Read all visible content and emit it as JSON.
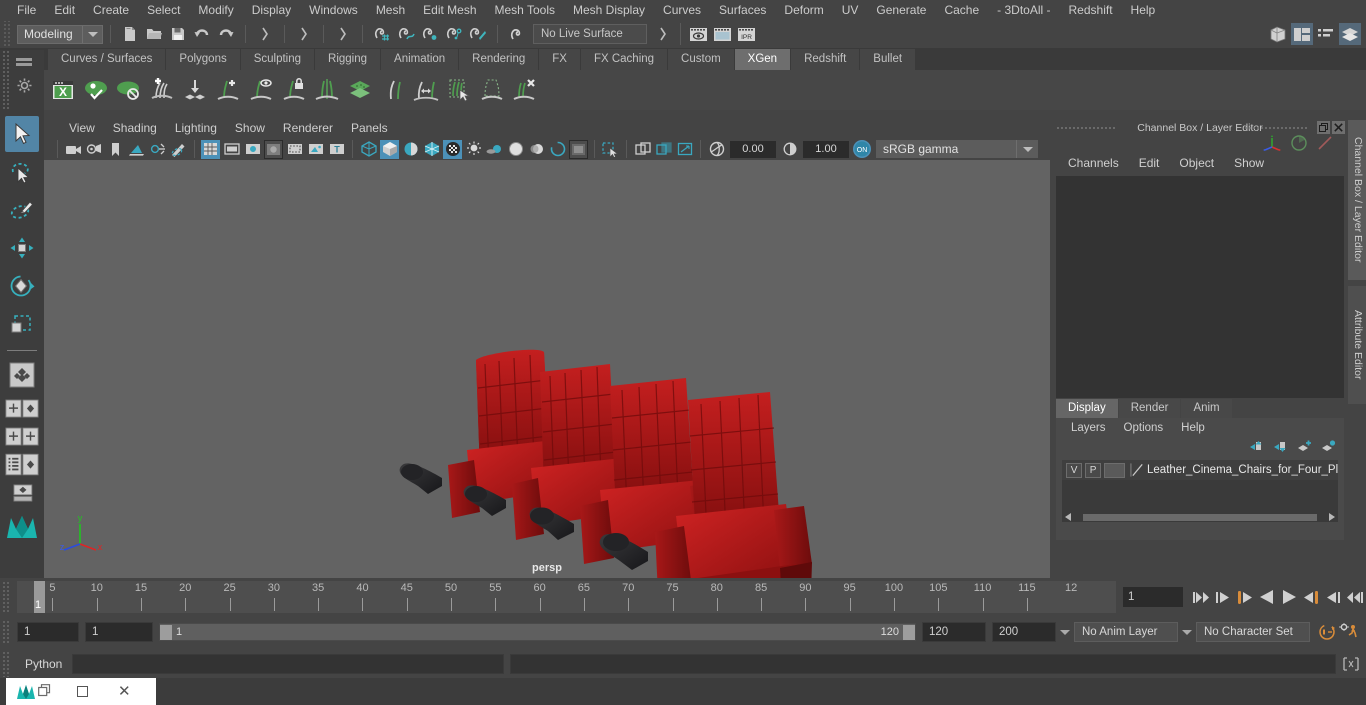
{
  "menubar": {
    "items": [
      "File",
      "Edit",
      "Create",
      "Select",
      "Modify",
      "Display",
      "Windows",
      "Mesh",
      "Edit Mesh",
      "Mesh Tools",
      "Mesh Display",
      "Curves",
      "Surfaces",
      "Deform",
      "UV",
      "Generate",
      "Cache",
      "- 3DtoAll -",
      "Redshift",
      "Help"
    ]
  },
  "statusline": {
    "menu_set": "Modeling",
    "live_surface": "No Live Surface",
    "icons": [
      "new-scene-icon",
      "open-scene-icon",
      "save-scene-icon",
      "undo-icon",
      "redo-icon",
      "select-by-hierarchy-icon",
      "select-by-object-icon",
      "select-by-component-icon",
      "snap-to-grid-icon",
      "snap-to-curve-icon",
      "snap-to-point-icon",
      "snap-to-projected-center-icon",
      "snap-to-view-plane-icon",
      "make-live-icon"
    ],
    "right_icons": [
      "show-hide-modeling-toolkit-icon",
      "show-hide-attribute-editor-icon",
      "show-hide-tool-settings-icon",
      "show-hide-channel-box-icon"
    ]
  },
  "shelf": {
    "tabs": [
      "Curves / Surfaces",
      "Polygons",
      "Sculpting",
      "Rigging",
      "Animation",
      "Rendering",
      "FX",
      "FX Caching",
      "Custom",
      "XGen",
      "Redshift",
      "Bullet"
    ],
    "active_tab": "XGen",
    "icons": [
      "xgen-editor-icon",
      "xgen-preview-icon",
      "xgen-disable-preview-icon",
      "xgen-add-clump-icon",
      "xgen-bake-icon",
      "xgen-add-guide-icon",
      "xgen-show-guide-icon",
      "xgen-lock-guide-icon",
      "xgen-mirror-guide-icon",
      "xgen-density-icon",
      "xgen-sculpt-guide-icon",
      "xgen-convert-icon",
      "xgen-select-guide-icon",
      "xgen-region-icon",
      "xgen-delete-guide-icon"
    ]
  },
  "toolbox": {
    "items": [
      "select-tool",
      "lasso-select-tool",
      "paint-select-tool",
      "move-tool",
      "rotate-tool",
      "scale-tool",
      "last-tool-used",
      "quick-layout-single-icon",
      "quick-layout-four-icon",
      "quick-layout-outliner-icon",
      "quick-layout-graph-icon",
      "maya-logo-icon"
    ],
    "selected": "select-tool"
  },
  "viewport": {
    "menus": [
      "View",
      "Shading",
      "Lighting",
      "Show",
      "Renderer",
      "Panels"
    ],
    "exposure_value": "0.00",
    "gamma_value": "1.00",
    "color_management": "sRGB gamma",
    "camera_label": "persp",
    "axis_labels": {
      "x": "x",
      "y": "y",
      "z": "z"
    },
    "toolbar_icons": [
      "select-camera-icon",
      "camera-attributes-icon",
      "bookmark-icon",
      "image-plane-icon",
      "two-d-pan-zoom-icon",
      "grease-pencil-icon",
      "grid-toggle-icon",
      "film-gate-icon",
      "resolution-gate-icon",
      "gate-mask-icon",
      "film-origin-icon",
      "safe-action-icon",
      "text-overlay-icon",
      "wireframe-icon",
      "smooth-shade-icon",
      "shade-toggle-icon",
      "wireframe-on-shaded-icon",
      "texture-toggle-icon",
      "lighting-toggle-icon",
      "shadow-toggle-icon",
      "screen-space-ao-icon",
      "motion-blur-icon",
      "multisample-icon",
      "depth-of-field-icon",
      "isolate-select-icon",
      "xray-icon",
      "xray-joints-icon",
      "xray-active-components-icon",
      "exposure-icon",
      "gamma-icon",
      "color-management-toggle-icon"
    ]
  },
  "channel_box": {
    "title": "Channel Box / Layer Editor",
    "menus": [
      "Channels",
      "Edit",
      "Object",
      "Show"
    ],
    "window_buttons": [
      "undock-icon",
      "close-icon"
    ],
    "header_icons": [
      "axis-gizmo-icon",
      "channel-box-icon",
      "attribute-editor-icon"
    ]
  },
  "layer_editor": {
    "tabs": [
      "Display",
      "Render",
      "Anim"
    ],
    "active_tab": "Display",
    "menus": [
      "Layers",
      "Options",
      "Help"
    ],
    "toolbar_icons": [
      "move-layer-up-icon",
      "move-layer-down-icon",
      "new-layer-icon",
      "new-layer-from-selected-icon"
    ],
    "layers": [
      {
        "visibility": "V",
        "playback": "P",
        "name": "Leather_Cinema_Chairs_for_Four_Plac"
      }
    ]
  },
  "sidebar_tabs": [
    "Channel Box / Layer Editor",
    "Attribute Editor"
  ],
  "timeslider": {
    "ticks": [
      5,
      10,
      15,
      20,
      25,
      30,
      35,
      40,
      45,
      50,
      55,
      60,
      65,
      70,
      75,
      80,
      85,
      90,
      95,
      100,
      105,
      110,
      115
    ],
    "last_partial_label": "12",
    "current_frame_label": "1",
    "current_frame_field": "1",
    "playback_buttons": [
      "go-to-start-icon",
      "step-back-keyframe-icon",
      "step-back-frame-icon",
      "play-backwards-icon",
      "play-forwards-icon",
      "step-forward-frame-icon",
      "step-forward-keyframe-icon",
      "go-to-end-icon"
    ]
  },
  "range": {
    "anim_start": "1",
    "range_start": "1",
    "slider_start_label": "1",
    "slider_end_label": "120",
    "range_end": "120",
    "anim_end": "200",
    "anim_layer": "No Anim Layer",
    "character_set": "No Character Set",
    "right_icons": [
      "auto-key-icon",
      "animation-preferences-icon"
    ]
  },
  "command_line": {
    "language": "Python",
    "input_value": "",
    "output_value": "",
    "script_editor_icon": "script-editor-icon"
  },
  "taskbar": {
    "window_title": "",
    "icons": [
      "maya-app-icon",
      "restore-window-icon",
      "maximize-window-icon",
      "close-window-icon"
    ]
  },
  "colors": {
    "accent_blue": "#4c91b8",
    "shelf_green": "#6aa84f",
    "panel_bg": "#444444",
    "viewport_bg": "#636363",
    "chair_red": "#b41818",
    "orange": "#d98c3a"
  }
}
